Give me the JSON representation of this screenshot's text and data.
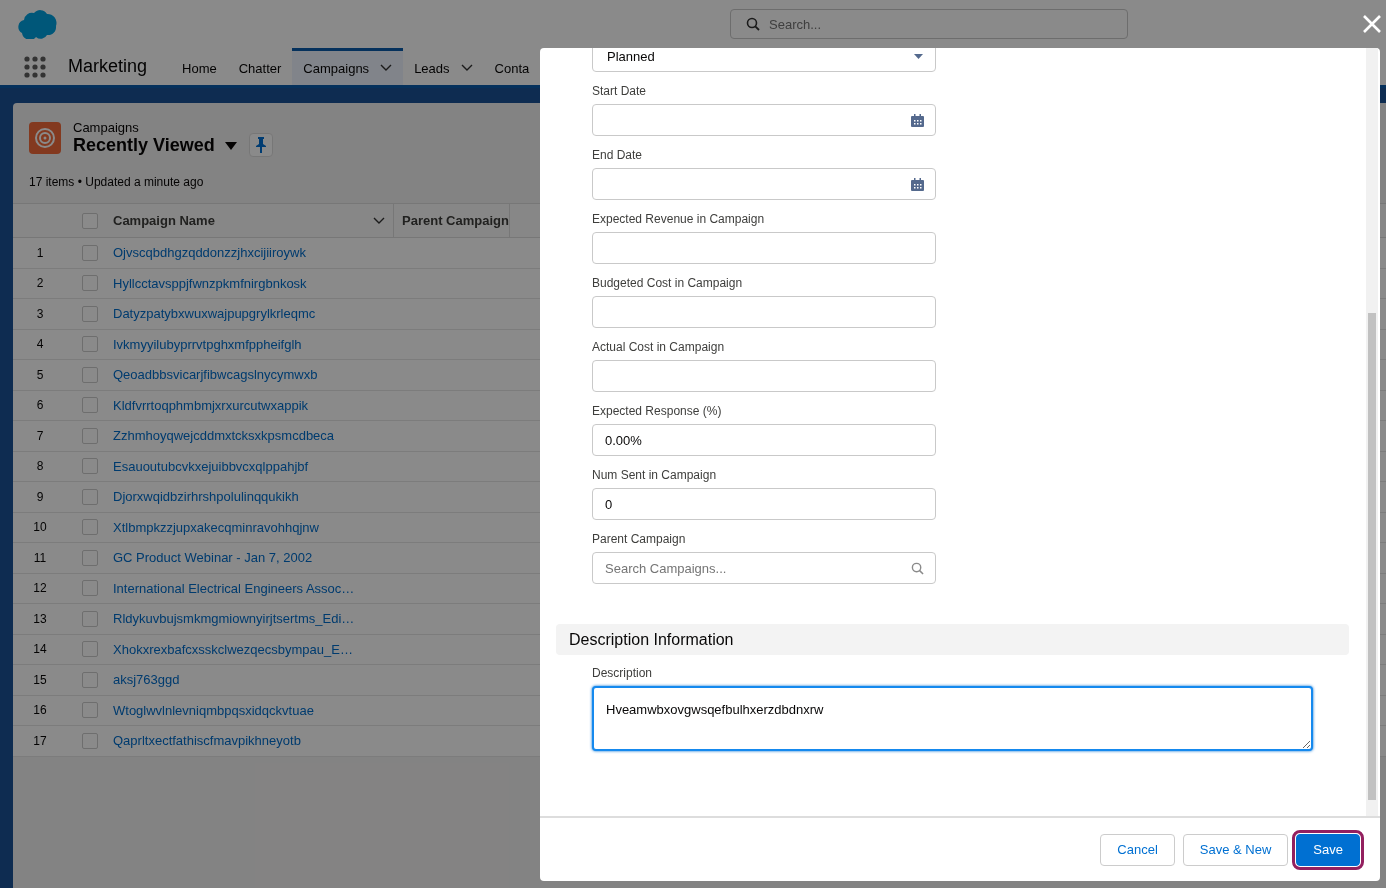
{
  "app": {
    "name": "Marketing"
  },
  "search": {
    "placeholder": "Search..."
  },
  "nav_tabs": [
    {
      "label": "Home",
      "selected": false,
      "has_menu": false
    },
    {
      "label": "Chatter",
      "selected": false,
      "has_menu": false
    },
    {
      "label": "Campaigns",
      "selected": true,
      "has_menu": true
    },
    {
      "label": "Leads",
      "selected": false,
      "has_menu": true
    },
    {
      "label": "Conta",
      "selected": false,
      "has_menu": false
    }
  ],
  "list_view": {
    "object": "Campaigns",
    "title": "Recently Viewed",
    "status": "17 items • Updated a minute ago"
  },
  "table": {
    "columns": [
      "Campaign Name",
      "Parent Campaign"
    ],
    "all_checked": false,
    "rows": [
      {
        "number": "1",
        "name": "Ojvscqbdhgzqddonzzjhxcijiiroywk",
        "checked": false
      },
      {
        "number": "2",
        "name": "Hyllcctavsppjfwnzpkmfnirgbnkosk",
        "checked": false
      },
      {
        "number": "3",
        "name": "Datyzpatybxwuxwajpupgrylkrleqmc",
        "checked": false
      },
      {
        "number": "4",
        "name": "Ivkmyyilubyprrvtpghxmfppheifglh",
        "checked": false
      },
      {
        "number": "5",
        "name": "Qeoadbbsvicarjfibwcagslnycymwxb",
        "checked": false
      },
      {
        "number": "6",
        "name": "Kldfvrrtoqphmbmjxrxurcutwxappik",
        "checked": false
      },
      {
        "number": "7",
        "name": "Zzhmhoyqwejcddmxtcksxkpsmcdbeca",
        "checked": false
      },
      {
        "number": "8",
        "name": "Esauoutubcvkxejuibbvcxqlppahjbf",
        "checked": false
      },
      {
        "number": "9",
        "name": "Djorxwqidbzirhrshpolulinqqukikh",
        "checked": false
      },
      {
        "number": "10",
        "name": "Xtlbmpkzzjupxakecqminravohhqjnw",
        "checked": false
      },
      {
        "number": "11",
        "name": "GC Product Webinar - Jan 7, 2002",
        "checked": false
      },
      {
        "number": "12",
        "name": "International Electrical Engineers Assoc…",
        "checked": false
      },
      {
        "number": "13",
        "name": "Rldykuvbujsmkmgmiownyirjtsertms_Edi…",
        "checked": false
      },
      {
        "number": "14",
        "name": "Xhokxrexbafcxsskclwezqecsbympau_E…",
        "checked": false
      },
      {
        "number": "15",
        "name": "aksj763ggd",
        "checked": false
      },
      {
        "number": "16",
        "name": "Wtoglwvlnlevniqmbpqsxidqckvtuae",
        "checked": false
      },
      {
        "number": "17",
        "name": "Qaprltxectfathiscfmavpikhneyotb",
        "checked": false
      }
    ]
  },
  "modal": {
    "fields": [
      {
        "kind": "select",
        "value": "Planned"
      },
      {
        "kind": "date",
        "label": "Start Date"
      },
      {
        "kind": "date",
        "label": "End Date"
      },
      {
        "kind": "text",
        "label": "Expected Revenue in Campaign"
      },
      {
        "kind": "text",
        "label": "Budgeted Cost in Campaign"
      },
      {
        "kind": "text",
        "label": "Actual Cost in Campaign"
      },
      {
        "kind": "text",
        "label": "Expected Response (%)",
        "value": "0.00%"
      },
      {
        "kind": "text",
        "label": "Num Sent in Campaign",
        "value": "0"
      },
      {
        "kind": "lookup",
        "label": "Parent Campaign",
        "placeholder": "Search Campaigns..."
      }
    ],
    "section": {
      "title": "Description Information"
    },
    "description": {
      "label": "Description",
      "value": "Hveamwbxovgwsqefbulhxerzdbdnxrw",
      "focused": true
    },
    "buttons": [
      {
        "label": "Cancel",
        "kind": "neutral",
        "focused": false
      },
      {
        "label": "Save & New",
        "kind": "neutral",
        "focused": false
      },
      {
        "label": "Save",
        "kind": "brand",
        "focused": true
      }
    ]
  }
}
